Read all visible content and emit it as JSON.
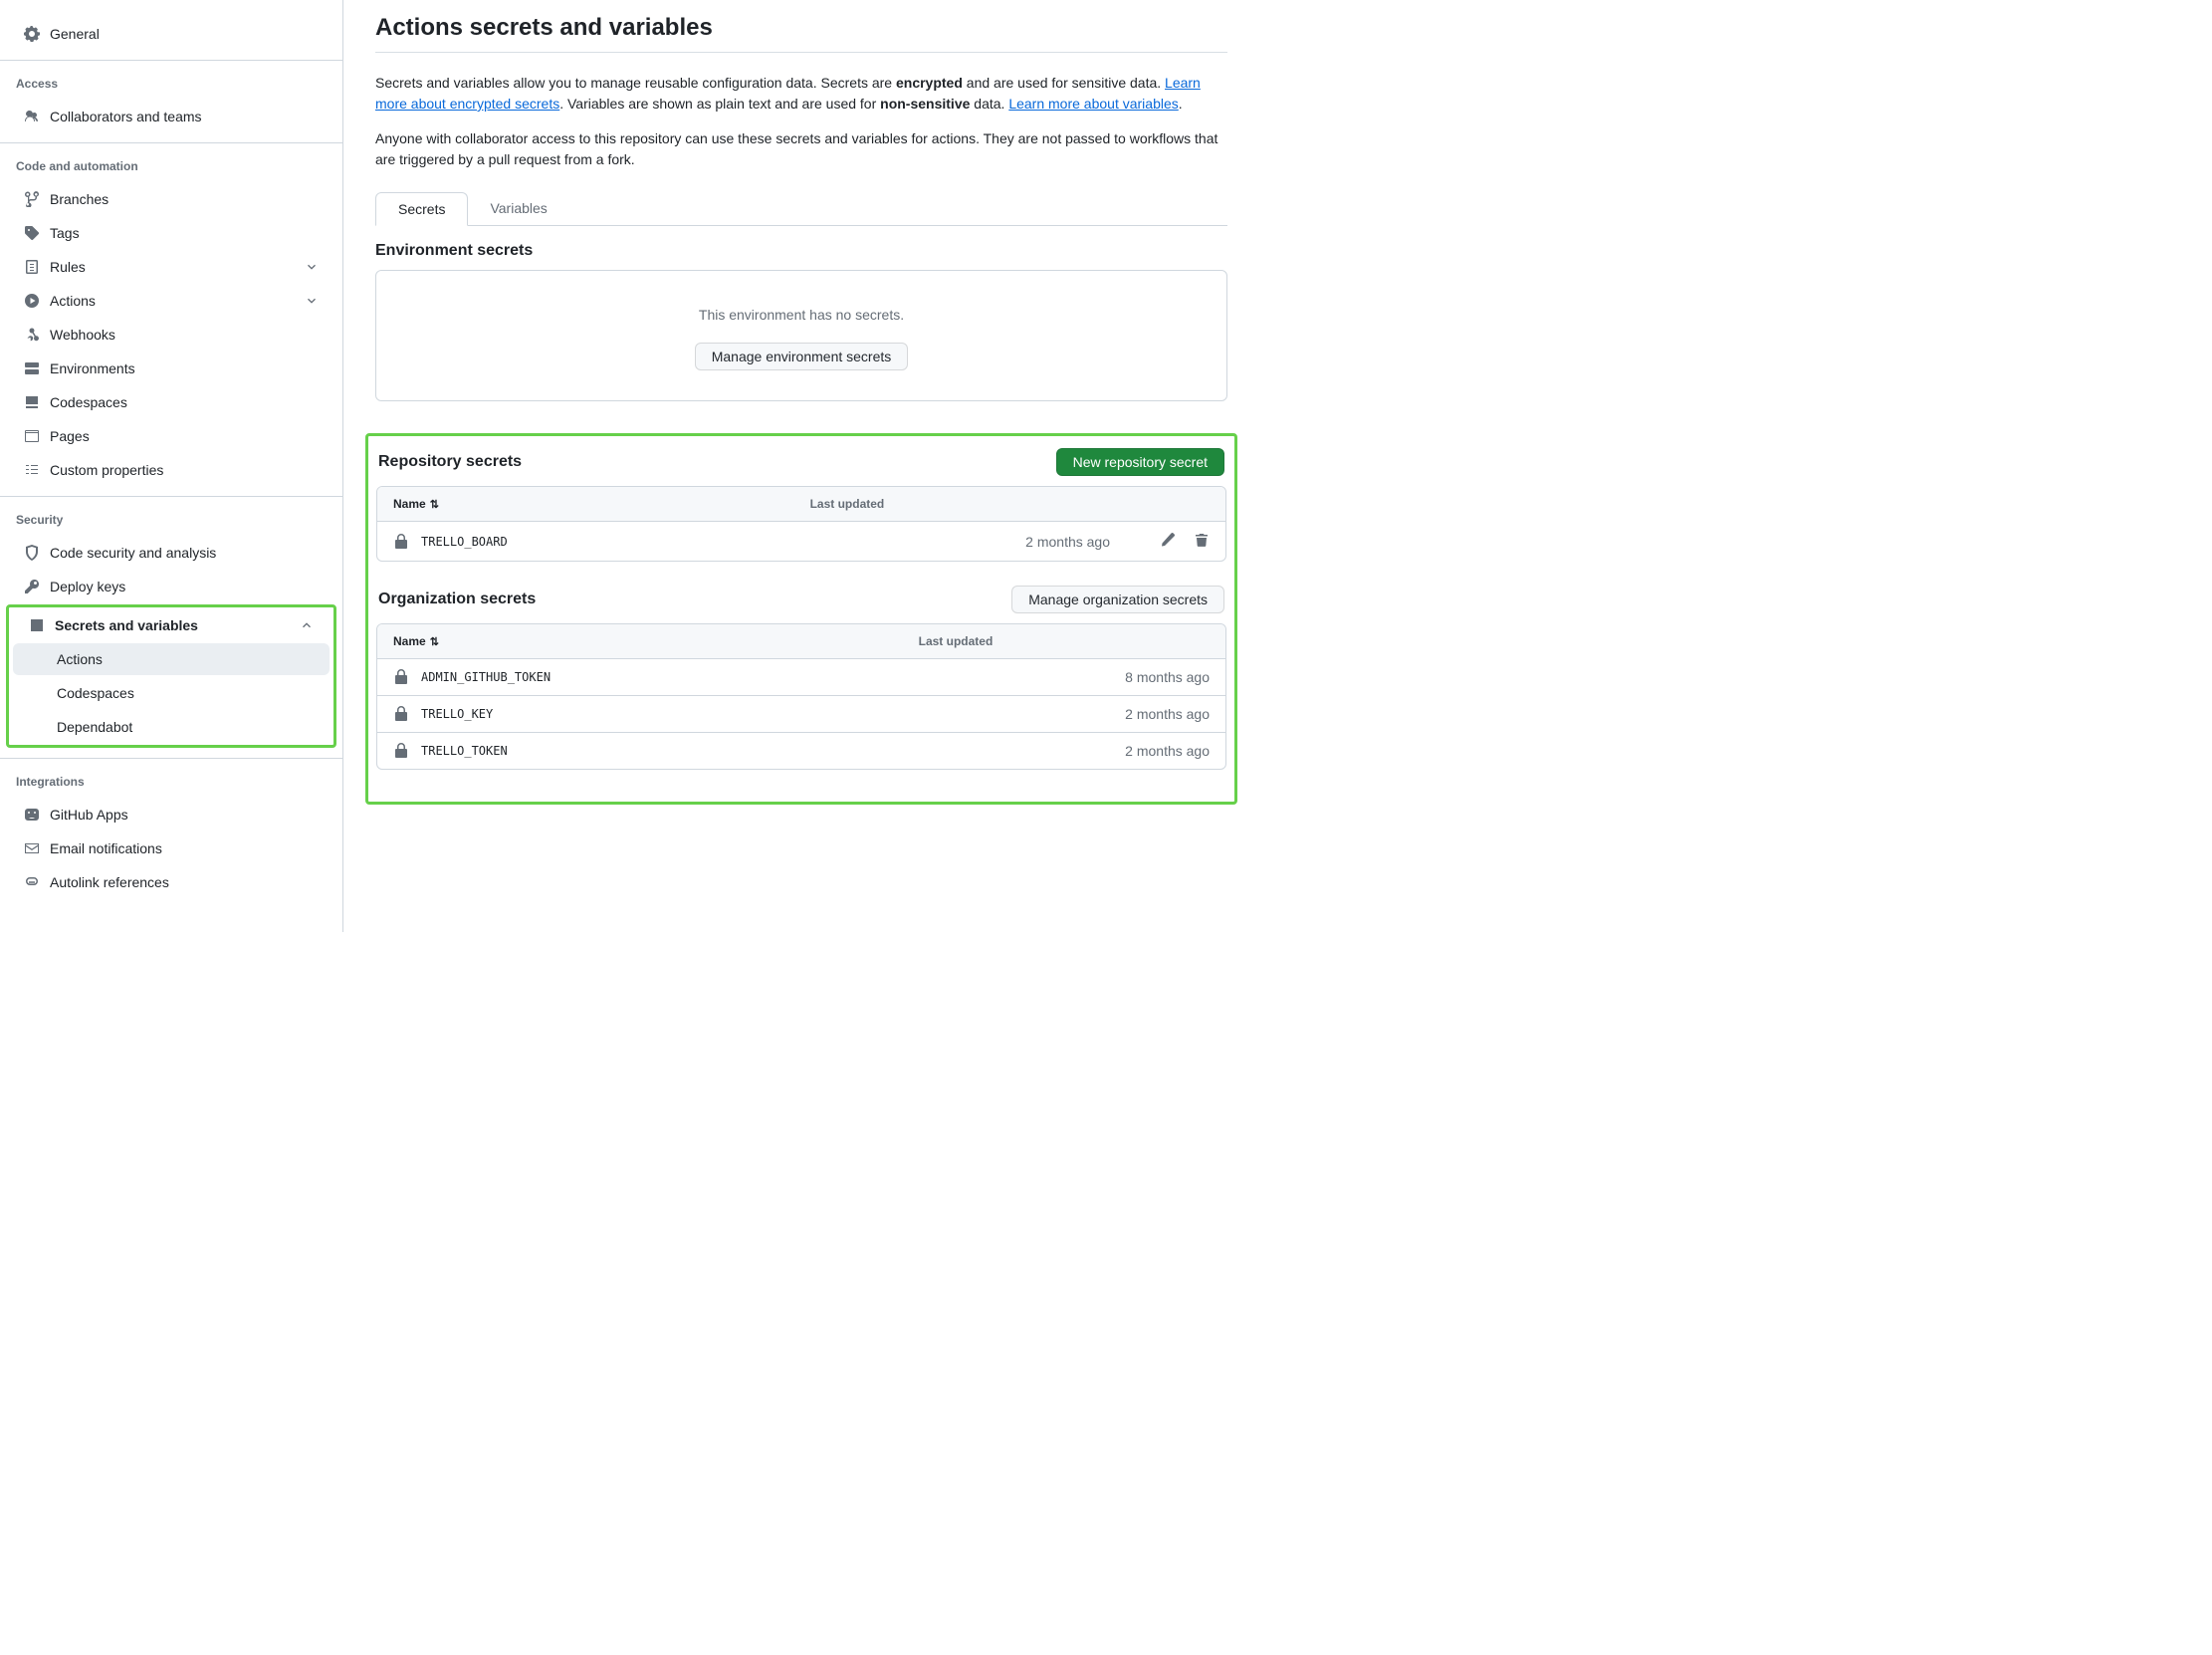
{
  "sidebar": {
    "general": "General",
    "access_heading": "Access",
    "collaborators": "Collaborators and teams",
    "code_heading": "Code and automation",
    "branches": "Branches",
    "tags": "Tags",
    "rules": "Rules",
    "actions": "Actions",
    "webhooks": "Webhooks",
    "environments": "Environments",
    "codespaces": "Codespaces",
    "pages": "Pages",
    "custom_properties": "Custom properties",
    "security_heading": "Security",
    "code_security": "Code security and analysis",
    "deploy_keys": "Deploy keys",
    "secrets_vars": "Secrets and variables",
    "sv_actions": "Actions",
    "sv_codespaces": "Codespaces",
    "sv_dependabot": "Dependabot",
    "integrations_heading": "Integrations",
    "github_apps": "GitHub Apps",
    "email_notifications": "Email notifications",
    "autolink": "Autolink references"
  },
  "page": {
    "title": "Actions secrets and variables",
    "intro1_a": "Secrets and variables allow you to manage reusable configuration data. Secrets are ",
    "intro1_strong": "encrypted",
    "intro1_b": " and are used for sensitive data. ",
    "link1": "Learn more about encrypted secrets",
    "intro1_c": ". Variables are shown as plain text and are used for ",
    "intro1_strong2": "non-sensitive",
    "intro1_d": " data. ",
    "link2": "Learn more about variables",
    "intro1_e": ".",
    "intro2": "Anyone with collaborator access to this repository can use these secrets and variables for actions. They are not passed to workflows that are triggered by a pull request from a fork.",
    "tab_secrets": "Secrets",
    "tab_variables": "Variables"
  },
  "env": {
    "title": "Environment secrets",
    "empty_msg": "This environment has no secrets.",
    "manage_btn": "Manage environment secrets"
  },
  "repo": {
    "title": "Repository secrets",
    "new_btn": "New repository secret",
    "col_name": "Name",
    "col_updated": "Last updated",
    "rows": [
      {
        "name": "TRELLO_BOARD",
        "updated": "2 months ago"
      }
    ]
  },
  "org": {
    "title": "Organization secrets",
    "manage_btn": "Manage organization secrets",
    "col_name": "Name",
    "col_updated": "Last updated",
    "rows": [
      {
        "name": "ADMIN_GITHUB_TOKEN",
        "updated": "8 months ago"
      },
      {
        "name": "TRELLO_KEY",
        "updated": "2 months ago"
      },
      {
        "name": "TRELLO_TOKEN",
        "updated": "2 months ago"
      }
    ]
  }
}
